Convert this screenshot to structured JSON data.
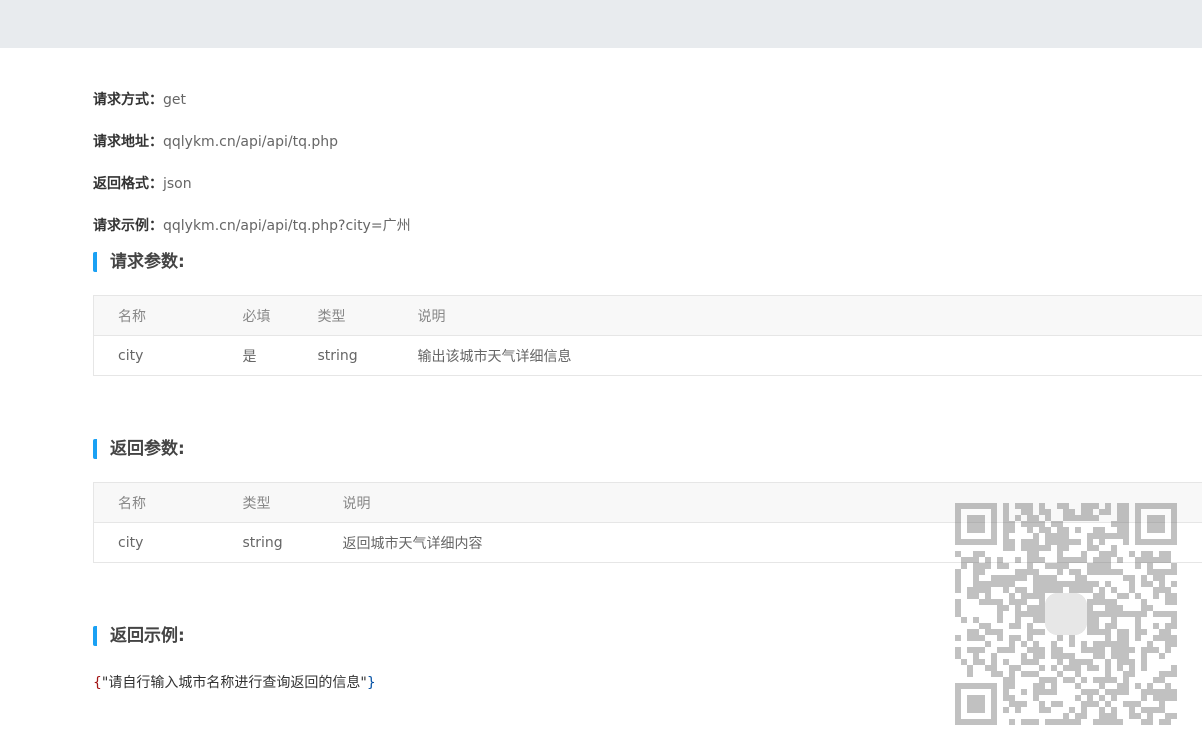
{
  "info": [
    {
      "label": "请求方式：",
      "value": "get"
    },
    {
      "label": "请求地址：",
      "value": "qqlykm.cn/api/api/tq.php"
    },
    {
      "label": "返回格式：",
      "value": "json"
    },
    {
      "label": "请求示例：",
      "value": "qqlykm.cn/api/api/tq.php?city=广州"
    }
  ],
  "request_params": {
    "title": "请求参数:",
    "headers": [
      "名称",
      "必填",
      "类型",
      "说明"
    ],
    "rows": [
      [
        "city",
        "是",
        "string",
        "输出该城市天气详细信息"
      ]
    ]
  },
  "response_params": {
    "title": "返回参数:",
    "headers": [
      "名称",
      "类型",
      "说明"
    ],
    "rows": [
      [
        "city",
        "string",
        "返回城市天气详细内容"
      ]
    ]
  },
  "example": {
    "title": "返回示例:",
    "open": "{",
    "body": "\"请自行输入城市名称进行查询返回的信息\"",
    "close": "}"
  }
}
